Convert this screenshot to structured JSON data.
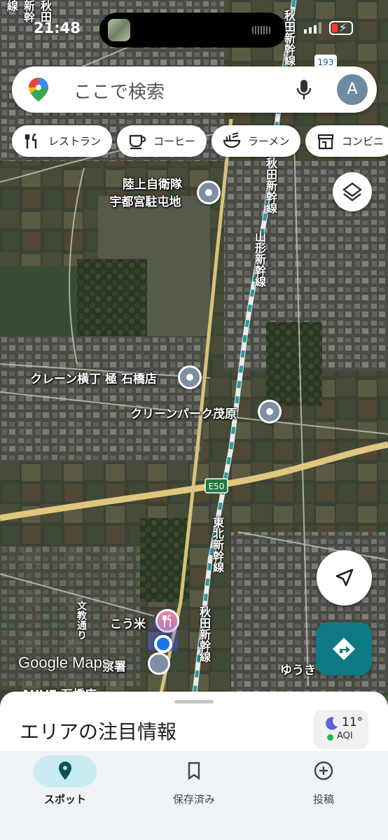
{
  "status": {
    "time": "21:48"
  },
  "search": {
    "placeholder": "ここで検索",
    "avatar_letter": "A"
  },
  "chips": [
    {
      "label": "レストラン",
      "icon": "fork-knife-icon"
    },
    {
      "label": "コーヒー",
      "icon": "coffee-cup-icon"
    },
    {
      "label": "ラーメン",
      "icon": "ramen-bowl-icon"
    },
    {
      "label": "コンビニ",
      "icon": "convenience-store-icon"
    }
  ],
  "map": {
    "pois": [
      {
        "label_line1": "陸上自衛隊",
        "label_line2": "宇都宮駐屯地"
      },
      {
        "label": "クレーン横丁 極 石橋店"
      },
      {
        "label": "クリーンパーク茂原"
      },
      {
        "label": "こう米"
      },
      {
        "label": "察署"
      },
      {
        "label": "ゆうき"
      },
      {
        "label": "AUVE 石橋店"
      }
    ],
    "rail_labels": [
      "秋田新幹線",
      "山形新幹線",
      "東北新幹線",
      "秋田新幹線",
      "東北新幹線",
      "東北新幹線"
    ],
    "road_labels": [
      "文教通り"
    ],
    "route_shields": [
      "193",
      "E50"
    ],
    "logo": "Google Maps"
  },
  "sheet": {
    "title": "エリアの注目情報",
    "weather": {
      "temp": "11°",
      "aqi": "AQI"
    }
  },
  "nav": {
    "items": [
      {
        "label": "スポット",
        "icon": "location-pin-icon",
        "active": true
      },
      {
        "label": "保存済み",
        "icon": "bookmark-icon",
        "active": false
      },
      {
        "label": "投稿",
        "icon": "add-circle-icon",
        "active": false
      }
    ]
  },
  "colors": {
    "accent": "#0f7a84",
    "nav_active": "#c8ecf1",
    "pin": "#7d8fa0",
    "restaurant_pin": "#e5849a",
    "location_dot": "#1a73e8"
  }
}
